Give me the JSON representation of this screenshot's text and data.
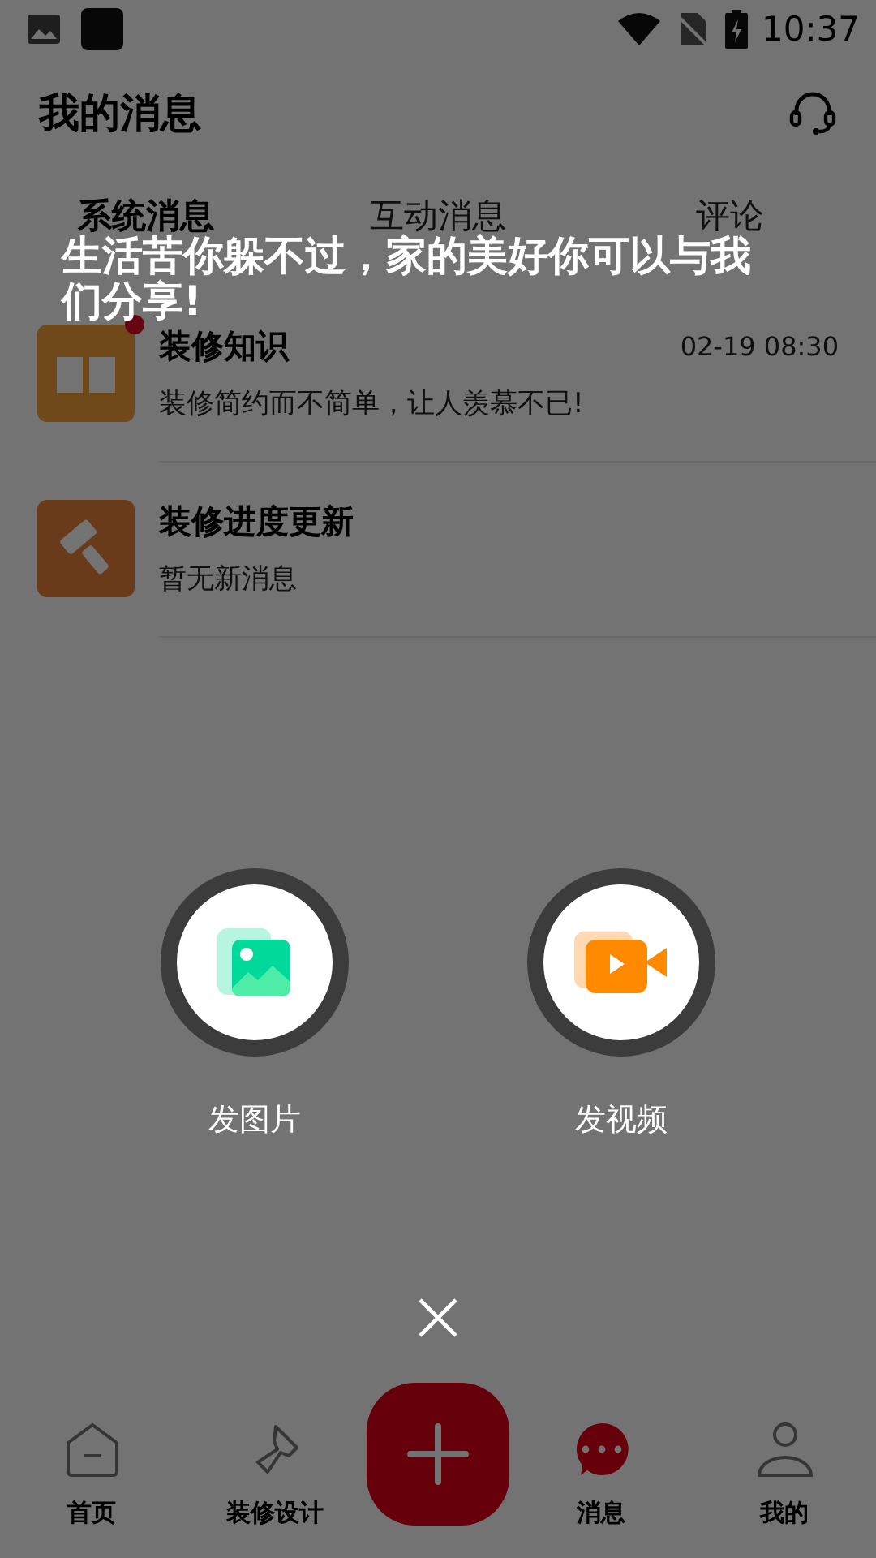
{
  "status_bar": {
    "time": "10:37"
  },
  "header": {
    "title": "我的消息"
  },
  "tabs": [
    {
      "label": "系统消息",
      "selected": true
    },
    {
      "label": "互动消息",
      "selected": false
    },
    {
      "label": "评论",
      "selected": false
    }
  ],
  "messages": [
    {
      "kind": "book",
      "title": "装修知识",
      "time": "02-19 08:30",
      "preview": "装修简约而不简单，让人羡慕不已!",
      "unread": true
    },
    {
      "kind": "roller",
      "title": "装修进度更新",
      "preview": "暂无新消息",
      "unread": false
    }
  ],
  "bottom_nav": [
    {
      "kind": "home",
      "label": "首页",
      "selected": false
    },
    {
      "kind": "brush",
      "label": "装修设计",
      "selected": false
    },
    {
      "kind": "add"
    },
    {
      "kind": "chat",
      "label": "消息",
      "selected": true
    },
    {
      "kind": "user",
      "label": "我的",
      "selected": false
    }
  ],
  "publish_menu": {
    "slogan": "生活苦你躲不过，家的美好你可以与我们分享!",
    "actions": [
      {
        "kind": "photo",
        "label": "发图片"
      },
      {
        "kind": "video",
        "label": "发视频"
      }
    ]
  }
}
